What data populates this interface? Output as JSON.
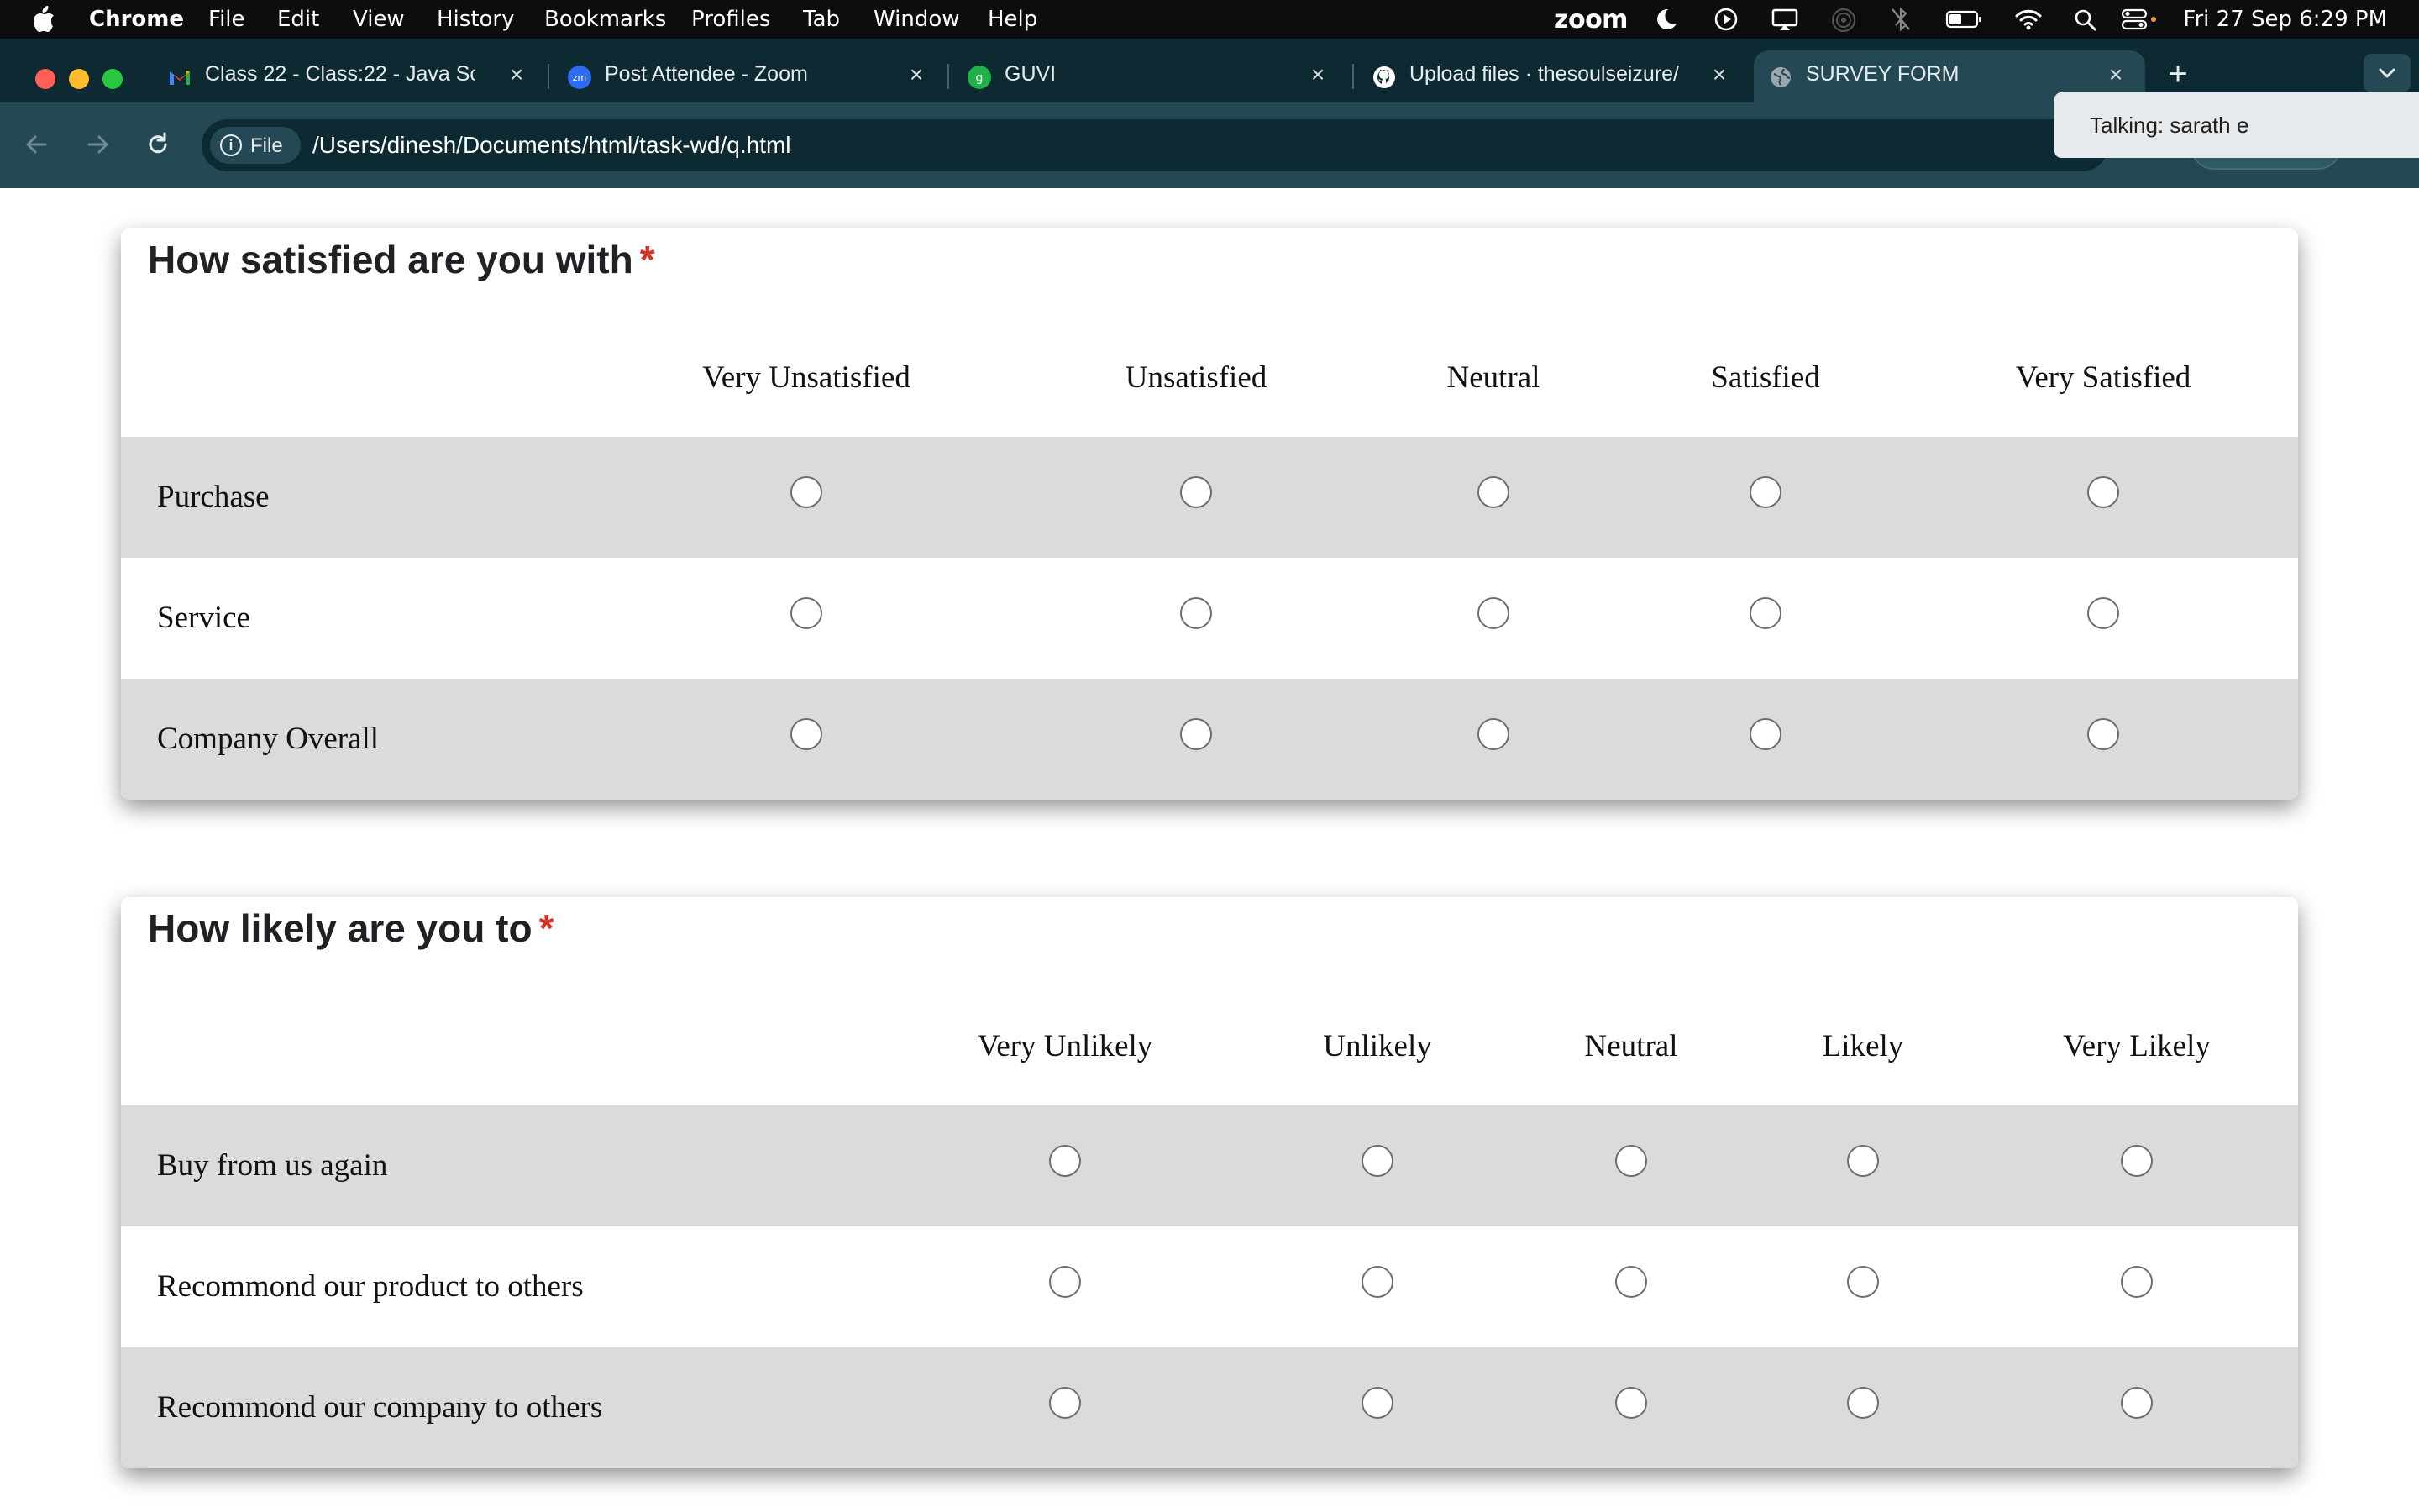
{
  "menubar": {
    "app_name": "Chrome",
    "items": [
      "File",
      "Edit",
      "View",
      "History",
      "Bookmarks",
      "Profiles",
      "Tab",
      "Window",
      "Help"
    ],
    "zoom_label": "zoom",
    "clock": "Fri 27 Sep  6:29 PM"
  },
  "tabs": [
    {
      "title": "Class 22 - Class:22 - Java Sc",
      "icon": "gmail-icon"
    },
    {
      "title": "Post Attendee - Zoom",
      "icon": "zoom-icon"
    },
    {
      "title": "GUVI",
      "icon": "guvi-icon"
    },
    {
      "title": "Upload files · thesoulseizure/",
      "icon": "github-icon"
    },
    {
      "title": "SURVEY FORM",
      "icon": "globe-icon",
      "active": true
    }
  ],
  "toolbar": {
    "site_chip": "File",
    "url": "/Users/dinesh/Documents/html/task-wd/q.html"
  },
  "zoom_tooltip": "Talking: sarath e",
  "survey": {
    "satisfaction": {
      "question": "How satisfied are you with",
      "required_mark": "*",
      "columns": [
        "Very Unsatisfied",
        "Unsatisfied",
        "Neutral",
        "Satisfied",
        "Very Satisfied"
      ],
      "rows": [
        "Purchase",
        "Service",
        "Company Overall"
      ]
    },
    "likelihood": {
      "question": "How likely are you to",
      "required_mark": "*",
      "columns": [
        "Very Unlikely",
        "Unlikely",
        "Neutral",
        "Likely",
        "Very Likely"
      ],
      "rows": [
        "Buy from us again",
        "Recommond our product to others",
        "Recommond our company to others"
      ]
    }
  },
  "colors": {
    "menubar_bg": "#0c0d0e",
    "tabstrip_bg": "#0d2a33",
    "toolbar_bg": "#254954",
    "row_shade": "#dcdbda",
    "required": "#d93025"
  }
}
